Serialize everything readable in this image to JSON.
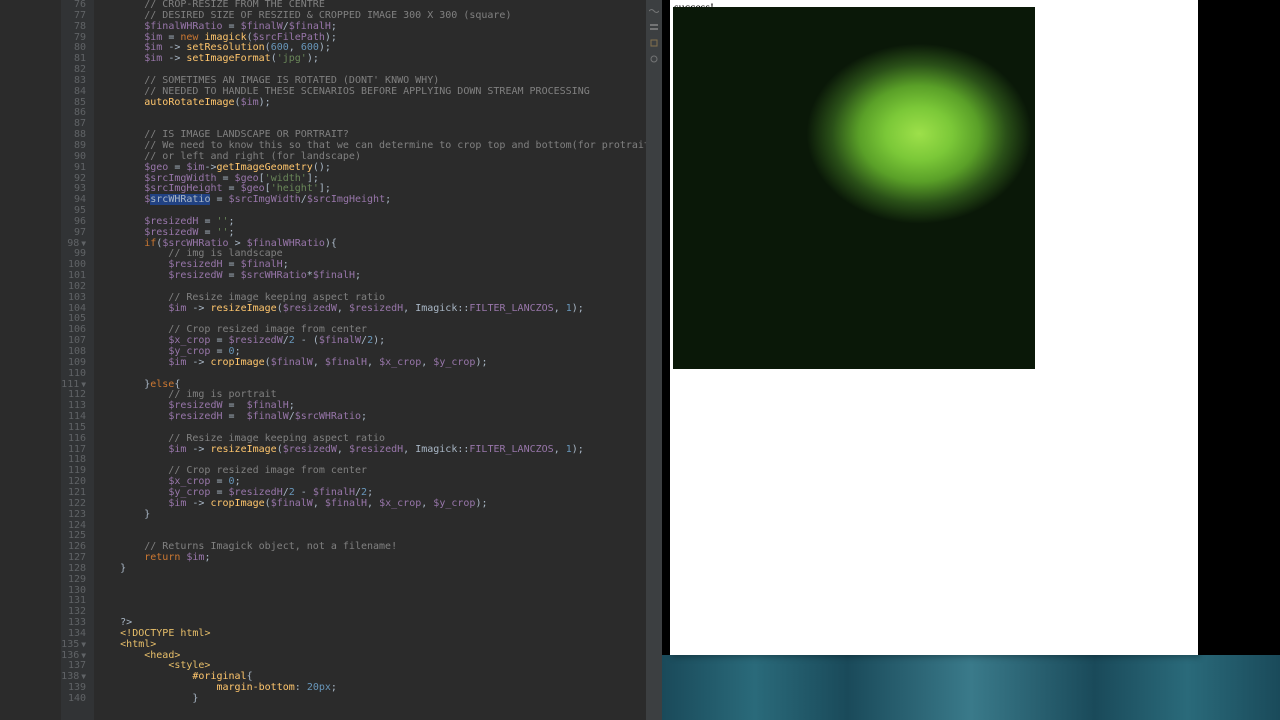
{
  "gutter": {
    "start": 76,
    "end": 140,
    "folds": [
      98,
      111,
      135,
      136,
      138
    ]
  },
  "code": [
    {
      "i": 0,
      "h": "        // CROP-RESIZE FROM THE CENTRE"
    },
    {
      "i": 0,
      "h": "        // DESIRED SIZE OF RESZIED & CROPPED IMAGE 300 X 300 (square)"
    },
    {
      "i": 0,
      "h": "        <v>$finalWHRatio</v> = <v>$finalW</v>/<v>$finalH</v>;"
    },
    {
      "i": 0,
      "h": "        <v>$im</v> = <k>new</k> <p>imagick</p>(<v>$srcFilePath</v>);"
    },
    {
      "i": 0,
      "h": "        <v>$im</v> -> <p>setResolution</p>(<n>600</n>, <n>600</n>);"
    },
    {
      "i": 0,
      "h": "        <v>$im</v> -> <p>setImageFormat</p>(<s>'jpg'</s>);"
    },
    {
      "i": 0,
      "h": ""
    },
    {
      "i": 0,
      "h": "        // SOMETIMES AN IMAGE IS ROTATED (DONT' KNWO WHY)"
    },
    {
      "i": 0,
      "h": "        // NEEDED TO HANDLE THESE SCENARIOS BEFORE APPLYING DOWN STREAM PROCESSING"
    },
    {
      "i": 0,
      "h": "        <p>autoRotateImage</p>(<v>$im</v>);"
    },
    {
      "i": 0,
      "h": ""
    },
    {
      "i": 0,
      "h": ""
    },
    {
      "i": 0,
      "h": "        // IS IMAGE LANDSCAPE OR PORTRAIT?"
    },
    {
      "i": 0,
      "h": "        // We need to know this so that we can determine to crop top and bottom(for protraits)"
    },
    {
      "i": 0,
      "h": "        // or left and right (for landscape)"
    },
    {
      "i": 0,
      "h": "        <v>$geo</v> = <v>$im</v>-><p>getImageGeometry</p>();"
    },
    {
      "i": 0,
      "h": "        <v>$srcImgWidth</v> = <v>$geo</v>[<s>'width'</s>];"
    },
    {
      "i": 0,
      "h": "        <v>$srcImgHeight</v> = <v>$geo</v>[<s>'height'</s>];"
    },
    {
      "i": 0,
      "h": "        <v>$</v><hl>srcWHRatio</hl> = <v>$srcImgWidth</v>/<v>$srcImgHeight</v>;"
    },
    {
      "i": 0,
      "h": ""
    },
    {
      "i": 0,
      "h": "        <v>$resizedH</v> = <s>''</s>;"
    },
    {
      "i": 0,
      "h": "        <v>$resizedW</v> = <s>''</s>;"
    },
    {
      "i": 0,
      "h": "        <k>if</k>(<v>$srcWHRatio</v> > <v>$finalWHRatio</v>){"
    },
    {
      "i": 0,
      "h": "            // img is landscape"
    },
    {
      "i": 0,
      "h": "            <v>$resizedH</v> = <v>$finalH</v>;"
    },
    {
      "i": 0,
      "h": "            <v>$resizedW</v> = <v>$srcWHRatio</v>*<v>$finalH</v>;"
    },
    {
      "i": 0,
      "h": ""
    },
    {
      "i": 0,
      "h": "            // Resize image keeping aspect ratio"
    },
    {
      "i": 0,
      "h": "            <v>$im</v> -> <p>resizeImage</p>(<v>$resizedW</v>, <v>$resizedH</v>, Imagick::<c>FILTER_LANCZOS</c>, <n>1</n>);"
    },
    {
      "i": 0,
      "h": ""
    },
    {
      "i": 0,
      "h": "            // Crop resized image from center"
    },
    {
      "i": 0,
      "h": "            <v>$x_crop</v> = <v>$resizedW</v>/<n>2</n> - (<v>$finalW</v>/<n>2</n>);"
    },
    {
      "i": 0,
      "h": "            <v>$y_crop</v> = <n>0</n>;"
    },
    {
      "i": 0,
      "h": "            <v>$im</v> -> <p>cropImage</p>(<v>$finalW</v>, <v>$finalH</v>, <v>$x_crop</v>, <v>$y_crop</v>);"
    },
    {
      "i": 0,
      "h": ""
    },
    {
      "i": 0,
      "h": "        }<k>else</k>{"
    },
    {
      "i": 0,
      "h": "            // img is portrait"
    },
    {
      "i": 0,
      "h": "            <v>$resizedW</v> =  <v>$finalH</v>;"
    },
    {
      "i": 0,
      "h": "            <v>$resizedH</v> =  <v>$finalW</v>/<v>$srcWHRatio</v>;"
    },
    {
      "i": 0,
      "h": ""
    },
    {
      "i": 0,
      "h": "            // Resize image keeping aspect ratio"
    },
    {
      "i": 0,
      "h": "            <v>$im</v> -> <p>resizeImage</p>(<v>$resizedW</v>, <v>$resizedH</v>, Imagick::<c>FILTER_LANCZOS</c>, <n>1</n>);"
    },
    {
      "i": 0,
      "h": ""
    },
    {
      "i": 0,
      "h": "            // Crop resized image from center"
    },
    {
      "i": 0,
      "h": "            <v>$x_crop</v> = <n>0</n>;"
    },
    {
      "i": 0,
      "h": "            <v>$y_crop</v> = <v>$resizedH</v>/<n>2</n> - <v>$finalH</v>/<n>2</n>;"
    },
    {
      "i": 0,
      "h": "            <v>$im</v> -> <p>cropImage</p>(<v>$finalW</v>, <v>$finalH</v>, <v>$x_crop</v>, <v>$y_crop</v>);"
    },
    {
      "i": 0,
      "h": "        }"
    },
    {
      "i": 0,
      "h": ""
    },
    {
      "i": 0,
      "h": ""
    },
    {
      "i": 0,
      "h": "        // Returns Imagick object, not a filename!"
    },
    {
      "i": 0,
      "h": "        <k>return</k> <v>$im</v>;"
    },
    {
      "i": 0,
      "h": "    }"
    },
    {
      "i": 0,
      "h": ""
    },
    {
      "i": 0,
      "h": ""
    },
    {
      "i": 0,
      "h": ""
    },
    {
      "i": 0,
      "h": ""
    },
    {
      "i": 0,
      "h": "    ?>"
    },
    {
      "i": 0,
      "h": "    <t>&lt;!DOCTYPE html&gt;</t>"
    },
    {
      "i": 0,
      "h": "    <t>&lt;html&gt;</t>"
    },
    {
      "i": 0,
      "h": "        <t>&lt;head&gt;</t>"
    },
    {
      "i": 0,
      "h": "            <t>&lt;style&gt;</t>"
    },
    {
      "i": 0,
      "h": "                <p>#original</p>{"
    },
    {
      "i": 0,
      "h": "                    <p>margin-bottom</p>: <n>20px</n>;"
    },
    {
      "i": 0,
      "h": "                }"
    }
  ],
  "preview": {
    "status": "success!"
  },
  "icons": [
    "wave",
    "stack",
    "cube",
    "circle"
  ]
}
